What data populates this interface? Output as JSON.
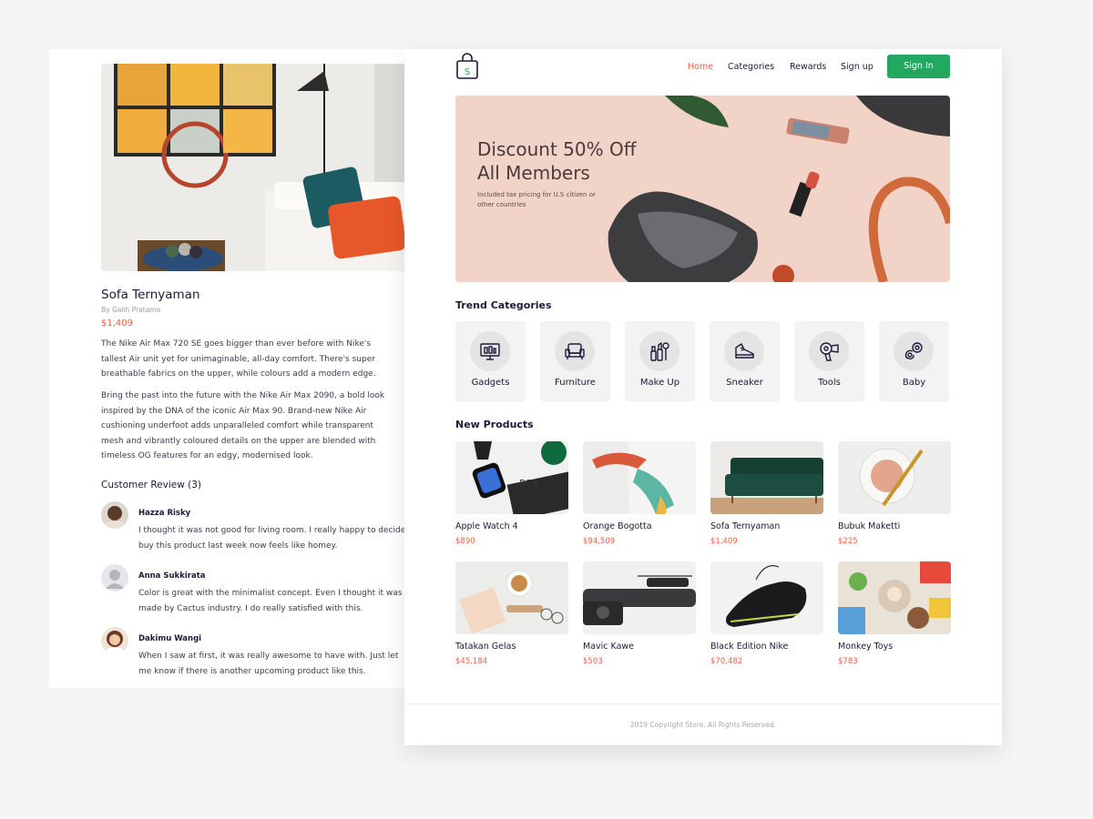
{
  "detail": {
    "title": "Sofa Ternyaman",
    "by": "By Galih Pratamo",
    "price": "$1,409",
    "desc1": "The Nike Air Max 720 SE goes bigger than ever before with Nike's tallest Air unit yet for unimaginable, all-day comfort. There's super breathable fabrics on the upper, while colours add a modern edge.",
    "desc2": "Bring the past into the future with the Nike Air Max 2090, a bold look inspired by the DNA of the iconic Air Max 90. Brand-new Nike Air cushioning underfoot adds unparalleled comfort while transparent mesh and vibrantly coloured details on the upper are blended with timeless OG features for an edgy, modernised look.",
    "review_heading": "Customer Review (3)",
    "reviews": [
      {
        "name": "Hazza Risky",
        "text": "I thought it was not good for living room. I really happy to decided buy this product last week now feels like homey."
      },
      {
        "name": "Anna Sukkirata",
        "text": "Color is great with the minimalist concept. Even I thought it was made by Cactus industry. I do really satisfied with this."
      },
      {
        "name": "Dakimu Wangi",
        "text": "When I saw at first, it was really awesome to have with. Just let me know if there is another upcoming product like this."
      }
    ]
  },
  "nav": {
    "home": "Home",
    "categories": "Categories",
    "rewards": "Rewards",
    "signup": "Sign up",
    "signin": "Sign In"
  },
  "banner": {
    "title": "Discount 50% Off All Members",
    "subtitle": "Included tax pricing for U.S citizen or other countries"
  },
  "trend": {
    "heading": "Trend Categories",
    "items": [
      {
        "label": "Gadgets",
        "icon": "gadgets-icon"
      },
      {
        "label": "Furniture",
        "icon": "armchair-icon"
      },
      {
        "label": "Make Up",
        "icon": "makeup-icon"
      },
      {
        "label": "Sneaker",
        "icon": "sneaker-icon"
      },
      {
        "label": "Tools",
        "icon": "hairdryer-icon"
      },
      {
        "label": "Baby",
        "icon": "pacifier-icon"
      }
    ]
  },
  "products": {
    "heading": "New Products",
    "items": [
      {
        "name": "Apple Watch 4",
        "price": "$890"
      },
      {
        "name": "Orange Bogotta",
        "price": "$94,509"
      },
      {
        "name": "Sofa Ternyaman",
        "price": "$1,409"
      },
      {
        "name": "Bubuk Maketti",
        "price": "$225"
      },
      {
        "name": "Tatakan Gelas",
        "price": "$45,184"
      },
      {
        "name": "Mavic Kawe",
        "price": "$503"
      },
      {
        "name": "Black Edition Nike",
        "price": "$70,482"
      },
      {
        "name": "Monkey Toys",
        "price": "$783"
      }
    ]
  },
  "footer": {
    "copyright": "2019 Copyright Store. All Rights Reserved."
  },
  "colors": {
    "accent": "#f15f42",
    "primary": "#23a85f",
    "banner_bg": "#f2d3c7"
  }
}
